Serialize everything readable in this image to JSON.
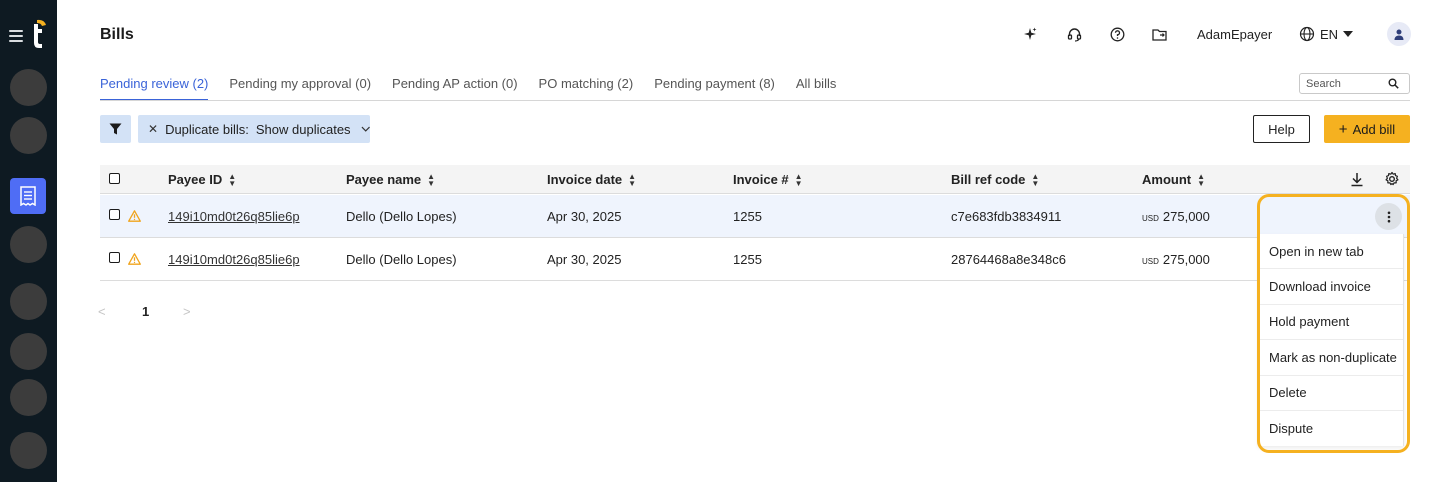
{
  "app": {
    "logo_letter": "t",
    "title": "Bills"
  },
  "header": {
    "username": "AdamEpayer",
    "language": "EN",
    "icons": [
      "sparkle-icon",
      "headset-icon",
      "help-circle-icon",
      "folder-arrow-icon",
      "globe-icon",
      "user-icon"
    ]
  },
  "tabs": [
    {
      "label": "Pending review (2)",
      "active": true
    },
    {
      "label": "Pending my approval (0)",
      "active": false
    },
    {
      "label": "Pending AP action (0)",
      "active": false
    },
    {
      "label": "PO matching (2)",
      "active": false
    },
    {
      "label": "Pending payment (8)",
      "active": false
    },
    {
      "label": "All bills",
      "active": false
    }
  ],
  "search": {
    "placeholder": "Search",
    "value": ""
  },
  "filter": {
    "chip_label": "Duplicate bills:",
    "chip_value": "Show duplicates"
  },
  "actions": {
    "help_label": "Help",
    "add_label": "Add bill"
  },
  "table": {
    "columns": [
      "Payee ID",
      "Payee name",
      "Invoice date",
      "Invoice #",
      "Bill ref code",
      "Amount"
    ],
    "rows": [
      {
        "payee_id": "149i10md0t26q85lie6p",
        "payee_name": "Dello (Dello Lopes)",
        "invoice_date": "Apr 30, 2025",
        "invoice_no": "1255",
        "bill_ref": "c7e683fdb3834911",
        "currency": "USD",
        "amount": "275,000"
      },
      {
        "payee_id": "149i10md0t26q85lie6p",
        "payee_name": "Dello (Dello Lopes)",
        "invoice_date": "Apr 30, 2025",
        "invoice_no": "1255",
        "bill_ref": "28764468a8e348c6",
        "currency": "USD",
        "amount": "275,000"
      }
    ]
  },
  "pagination": {
    "current": "1"
  },
  "context_menu": {
    "items": [
      "Open in new tab",
      "Download invoice",
      "Hold payment",
      "Mark as non-duplicate",
      "Delete",
      "Dispute"
    ]
  },
  "colors": {
    "sidebar": "#0e1a22",
    "accent": "#3a63d8",
    "primary_button": "#f5b120",
    "chip_bg": "#d3e2f6",
    "warning": "#f0a41c"
  }
}
